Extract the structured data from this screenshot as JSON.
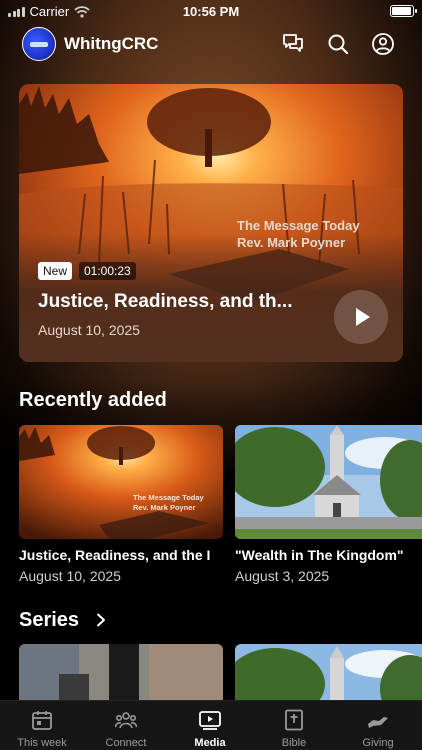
{
  "status_bar": {
    "carrier": "Carrier",
    "time": "10:56 PM",
    "battery_level": 1.0
  },
  "header": {
    "app_name": "WhitngCRC",
    "icons": [
      "chat-icon",
      "search-icon",
      "profile-icon"
    ]
  },
  "featured": {
    "badge": "New",
    "duration": "01:00:23",
    "title": "Justice, Readiness, and th...",
    "date": "August 10, 2025",
    "overlay_line1": "The Message Today",
    "overlay_line2": "Rev. Mark Poyner"
  },
  "recently_added": {
    "heading": "Recently added",
    "items": [
      {
        "title": "Justice, Readiness, and the I",
        "date": "August 10, 2025",
        "overlay_line1": "The Message Today",
        "overlay_line2": "Rev. Mark Poyner"
      },
      {
        "title": "\"Wealth in The Kingdom\"",
        "date": "August 3, 2025"
      }
    ]
  },
  "series": {
    "heading": "Series"
  },
  "tabs": [
    {
      "label": "This week",
      "icon": "calendar-icon",
      "active": false
    },
    {
      "label": "Connect",
      "icon": "people-icon",
      "active": false
    },
    {
      "label": "Media",
      "icon": "play-screen-icon",
      "active": true
    },
    {
      "label": "Bible",
      "icon": "bible-icon",
      "active": false
    },
    {
      "label": "Giving",
      "icon": "giving-hand-icon",
      "active": false
    }
  ]
}
